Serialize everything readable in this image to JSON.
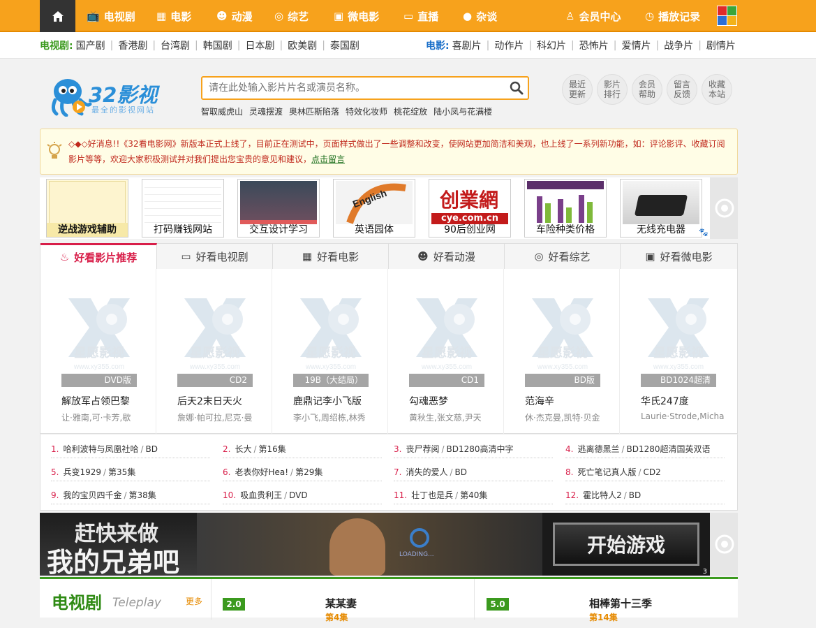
{
  "topnav": {
    "items": [
      {
        "label": "电视剧",
        "icon": "tv-icon"
      },
      {
        "label": "电影",
        "icon": "film-icon"
      },
      {
        "label": "动漫",
        "icon": "anime-icon"
      },
      {
        "label": "综艺",
        "icon": "variety-icon"
      },
      {
        "label": "微电影",
        "icon": "micro-film-icon"
      },
      {
        "label": "直播",
        "icon": "monitor-icon"
      },
      {
        "label": "杂谈",
        "icon": "chat-icon"
      }
    ],
    "member": "会员中心",
    "history": "播放记录",
    "colors": {
      "bar": "#f7a21c",
      "home": "#333333"
    }
  },
  "subnav": {
    "tv_head": "电视剧:",
    "tv_items": [
      "国产剧",
      "香港剧",
      "台湾剧",
      "韩国剧",
      "日本剧",
      "欧美剧",
      "泰国剧"
    ],
    "movie_head": "电影:",
    "movie_items": [
      "喜剧片",
      "动作片",
      "科幻片",
      "恐怖片",
      "爱情片",
      "战争片",
      "剧情片"
    ]
  },
  "header": {
    "logo_main": "32影视",
    "logo_sub": "最全的影视网站",
    "search_placeholder": "请在此处输入影片片名或演员名称。",
    "hotwords": [
      "智取威虎山",
      "灵魂摆渡",
      "奥林匹斯陷落",
      "特效化妆师",
      "桃花绽放",
      "陆小凤与花满楼"
    ],
    "circle_buttons": [
      {
        "l1": "最近",
        "l2": "更新"
      },
      {
        "l1": "影片",
        "l2": "排行"
      },
      {
        "l1": "会员",
        "l2": "帮助"
      },
      {
        "l1": "留言",
        "l2": "反馈"
      },
      {
        "l1": "收藏",
        "l2": "本站"
      }
    ]
  },
  "notice": {
    "text": "◇◆◇好消息!!《32看电影网》新版本正式上线了，目前正在测试中，页面样式做出了一些调整和改变，使网站更加简洁和美观，也上线了一系列新功能，如：评论影评、收藏订阅影片等等，欢迎大家积极测试并对我们提出您宝贵的意见和建议，",
    "link": "点击留言"
  },
  "ads": [
    "逆战游戏辅助",
    "打码赚钱网站",
    "交互设计学习",
    "英语园体",
    "90后创业网",
    "车险种类价格",
    "无线充电器"
  ],
  "ad_images": {
    "english_text": "English",
    "cye_logo": "创業網",
    "cye_url": "cye.com.cn"
  },
  "tabs": [
    {
      "label": "好看影片推荐",
      "icon": "fire-icon"
    },
    {
      "label": "好看电视剧",
      "icon": "tv-icon"
    },
    {
      "label": "好看电影",
      "icon": "film-icon"
    },
    {
      "label": "好看动漫",
      "icon": "anime-icon"
    },
    {
      "label": "好看综艺",
      "icon": "variety-icon"
    },
    {
      "label": "好看微电影",
      "icon": "micro-film-icon"
    }
  ],
  "poster_watermark": {
    "name": "星愿影视",
    "url": "www.xy355.com"
  },
  "movies": [
    {
      "badge": "DVD版",
      "title": "解放军占领巴黎",
      "cast": "让·雅南,可·卡芳,歇"
    },
    {
      "badge": "CD2",
      "title": "后天2末日天火",
      "cast": "詹娜·帕可拉,尼克·曼"
    },
    {
      "badge": "19B（大结局）",
      "title": "鹿鼎记李小飞版",
      "cast": "李小飞,周绍栋,林秀"
    },
    {
      "badge": "CD1",
      "title": "勾魂恶梦",
      "cast": "黄秋生,张文慈,尹天"
    },
    {
      "badge": "BD版",
      "title": "范海辛",
      "cast": "休·杰克曼,凯特·贝金"
    },
    {
      "badge": "BD1024超清",
      "title": "华氏247度",
      "cast": "Laurie·Strode,Micha"
    }
  ],
  "ranks": [
    {
      "n": "1.",
      "title": "哈利波特与凤凰社哈",
      "info": "BD"
    },
    {
      "n": "2.",
      "title": "长大",
      "info": "第16集"
    },
    {
      "n": "3.",
      "title": "丧尸荐阅",
      "info": "BD1280高清中字"
    },
    {
      "n": "4.",
      "title": "逃离德黑兰",
      "info": "BD1280超清国英双语"
    },
    {
      "n": "5.",
      "title": "兵变1929",
      "info": "第35集"
    },
    {
      "n": "6.",
      "title": "老表你好Hea!",
      "info": "第29集"
    },
    {
      "n": "7.",
      "title": "消失的爱人",
      "info": "BD"
    },
    {
      "n": "8.",
      "title": "死亡笔记真人版",
      "info": "CD2"
    },
    {
      "n": "9.",
      "title": "我的宝贝四千金",
      "info": "第38集"
    },
    {
      "n": "10.",
      "title": "吸血贵利王",
      "info": "DVD"
    },
    {
      "n": "11.",
      "title": "壮丁也是兵",
      "info": "第40集"
    },
    {
      "n": "12.",
      "title": "霍比特人2",
      "info": "BD"
    }
  ],
  "banner": {
    "line1": "赶快来做",
    "line2": "我的兄弟吧",
    "button": "开始游戏",
    "loading": "LOADING...",
    "page": "3"
  },
  "tv_section": {
    "title": "电视剧",
    "subtitle": "Teleplay",
    "more": "更多",
    "items": [
      {
        "score": "2.0",
        "title": "某某妻",
        "episode": "第4集"
      },
      {
        "score": "5.0",
        "title": "相棒第十三季",
        "episode": "第14集"
      }
    ]
  }
}
